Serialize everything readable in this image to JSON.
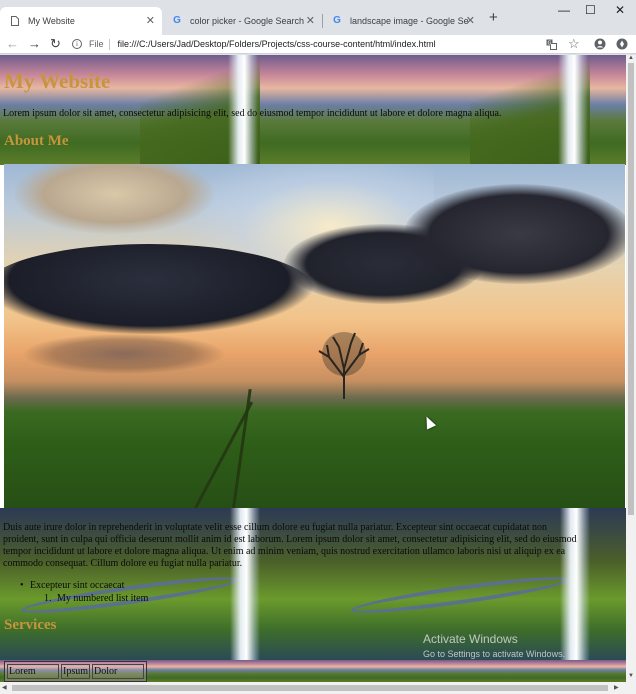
{
  "browser": {
    "tabs": [
      {
        "title": "My Website",
        "icon": "page-icon",
        "active": true
      },
      {
        "title": "color picker - Google Search",
        "icon": "google-icon",
        "active": false
      },
      {
        "title": "landscape image - Google Search",
        "icon": "google-icon",
        "active": false
      }
    ],
    "new_tab": "+",
    "window_controls": {
      "minimize": "—",
      "maximize": "☐",
      "close": "✕"
    },
    "nav": {
      "back": "←",
      "forward": "→",
      "reload": "↻"
    },
    "address": {
      "scheme_label": "File",
      "url": "file:///C:/Users/Jad/Desktop/Folders/Projects/css-course-content/html/index.html"
    },
    "toolbar_icons": [
      "translate-icon",
      "star-icon",
      "account-icon",
      "extension-icon"
    ]
  },
  "page": {
    "site_title": "My Website",
    "intro_text": "Lorem ipsum dolor sit amet, consectetur adipisicing elit, sed do eiusmod tempor incididunt ut labore et dolore magna aliqua.",
    "about_heading": "About Me",
    "about_text_1": "Duis aute irure dolor in reprehenderit in voluptate velit esse cillum dolore eu fugiat nulla pariatur. Excepteur sint occaecat cupidatat non",
    "about_text_2": "proident, sunt in culpa qui officia deserunt mollit anim id est laborum. Lorem ipsum dolor sit amet, consectetur adipisicing elit, sed do eiusmod",
    "about_text_3": "tempor incididunt ut labore et dolore magna aliqua. Ut enim ad minim veniam, quis nostrud exercitation ullamco laboris nisi ut aliquip ex ea",
    "about_text_4": "commodo consequat. Cillum dolore eu fugiat nulla pariatur.",
    "bullet_item": "Excepteur sint occaecat",
    "numbered_item": "My numbered list item",
    "bullet_marker": "•",
    "numbered_marker": "1.",
    "services_heading": "Services",
    "table_cells": [
      "Lorem",
      "Ipsum",
      "Dolor"
    ]
  },
  "overlay": {
    "watermark_title": "Activate Windows",
    "watermark_sub": "Go to Settings to activate Windows."
  },
  "colors": {
    "heading": "#c7953b",
    "tab_bar": "#dee1e6"
  }
}
